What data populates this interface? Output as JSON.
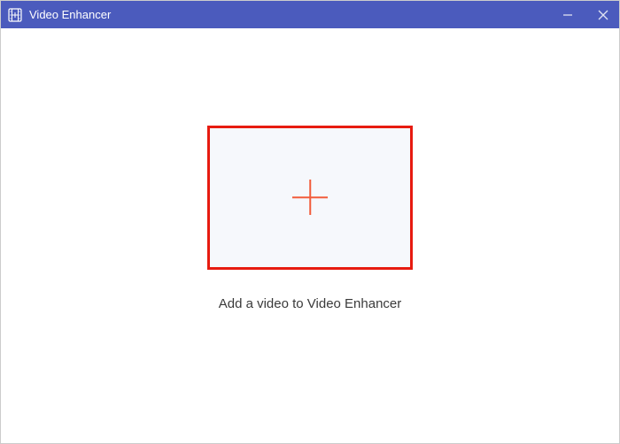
{
  "titlebar": {
    "app_title": "Video Enhancer"
  },
  "main": {
    "instruction_text": "Add a video to Video Enhancer"
  },
  "colors": {
    "titlebar_bg": "#4b5bbd",
    "highlight_border": "#e71b10",
    "plus_icon": "#f25c3b",
    "dropzone_bg": "#f6f8fc"
  }
}
